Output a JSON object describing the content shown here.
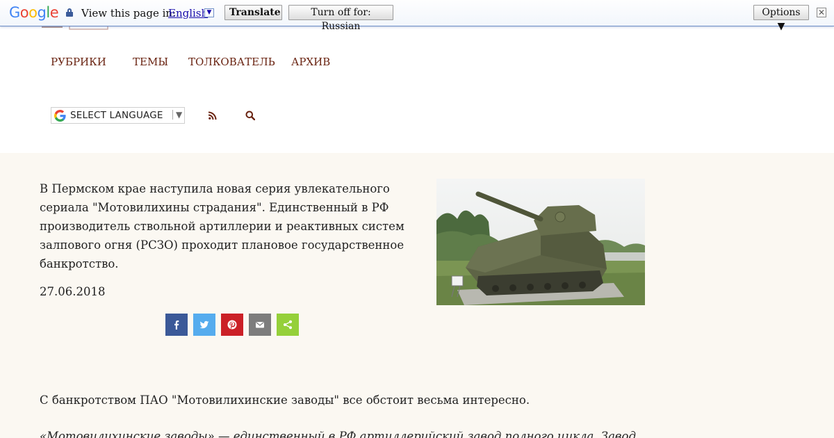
{
  "translate_bar": {
    "logo": [
      "G",
      "o",
      "o",
      "g",
      "l",
      "e"
    ],
    "logo_colors": [
      "#4285f4",
      "#ea4335",
      "#fbbc05",
      "#4285f4",
      "#34a853",
      "#ea4335"
    ],
    "view_label": "View this page in:",
    "language": "English",
    "translate_label": "Translate",
    "turn_off_label": "Turn off for: Russian",
    "options_label": "Options ▼",
    "close_glyph": "✕"
  },
  "nav": {
    "items": [
      "РУБРИКИ",
      "ТЕМЫ",
      "ТОЛКОВАТЕЛЬ",
      "АРХИВ"
    ],
    "color": "#6a2412"
  },
  "language_select": {
    "label": "SELECT LANGUAGE",
    "arrow": "▼"
  },
  "article": {
    "lead": "В Пермском крае наступила новая серия увлекательного сериала \"Мотовилихины страдания\". Единственный в РФ производитель ствольной артиллерии и реактивных систем залпового огня (РСЗО) проходит плановое государственное банкротство.",
    "date": "27.06.2018",
    "paragraph_1": "С банкротством ПАО \"Мотовилихинские заводы\" все обстоит весьма интересно.",
    "paragraph_2": "«Мотовилихинские заводы» — единственный в РФ артиллерийский завод полного цикла. Завод"
  },
  "share": {
    "buttons": [
      "facebook",
      "twitter",
      "pinterest",
      "email",
      "share"
    ],
    "colors": [
      "#3b5998",
      "#55acee",
      "#cb2027",
      "#7d7d7d",
      "#95d03a"
    ]
  },
  "colors": {
    "content_bg": "#fbf8f2",
    "accent": "#6a2412"
  }
}
